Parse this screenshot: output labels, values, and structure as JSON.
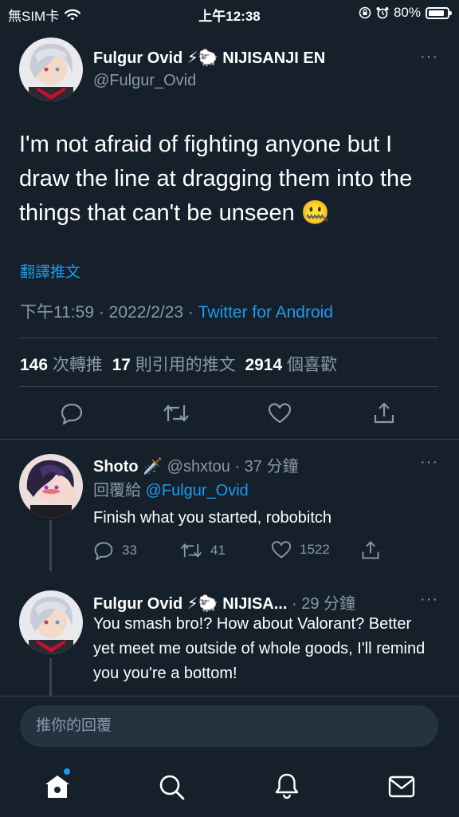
{
  "status_bar": {
    "carrier": "無SIM卡",
    "time": "上午12:38",
    "battery": "80%"
  },
  "main_tweet": {
    "author_name": "Fulgur Ovid ⚡🐑 NIJISANJI EN",
    "handle": "@Fulgur_Ovid",
    "text": "I'm not afraid of fighting anyone but I draw the line at dragging them into the things that can't be unseen 🤐",
    "translate_label": "翻譯推文",
    "timestamp": "下午11:59 · 2022/2/23 · ",
    "source": "Twitter for Android",
    "retweets_count": "146",
    "retweets_label": "次轉推",
    "quotes_count": "17",
    "quotes_label": "則引用的推文",
    "likes_count": "2914",
    "likes_label": "個喜歡"
  },
  "replies": [
    {
      "author_name": "Shoto 🗡️",
      "meta": "@shxtou · 37 分鐘",
      "reply_to_label": "回覆給 ",
      "reply_to_handle": "@Fulgur_Ovid",
      "text": "Finish what you started, robobitch",
      "reply_count": "33",
      "retweet_count": "41",
      "like_count": "1522"
    },
    {
      "author_name": "Fulgur Ovid ⚡🐑 NIJISA...",
      "meta": " · 29 分鐘",
      "text": "You smash bro!? How about Valorant? Better yet meet me outside of whole goods, I'll remind you you're a bottom!"
    }
  ],
  "compose": {
    "placeholder": "推你的回覆"
  },
  "icons": {
    "more": "···",
    "nav": [
      "home-icon",
      "search-icon",
      "notifications-icon",
      "messages-icon"
    ]
  },
  "colors": {
    "background": "#15202b",
    "accent": "#1d9bf0",
    "secondary_text": "#8899a6",
    "divider": "#38444d"
  }
}
